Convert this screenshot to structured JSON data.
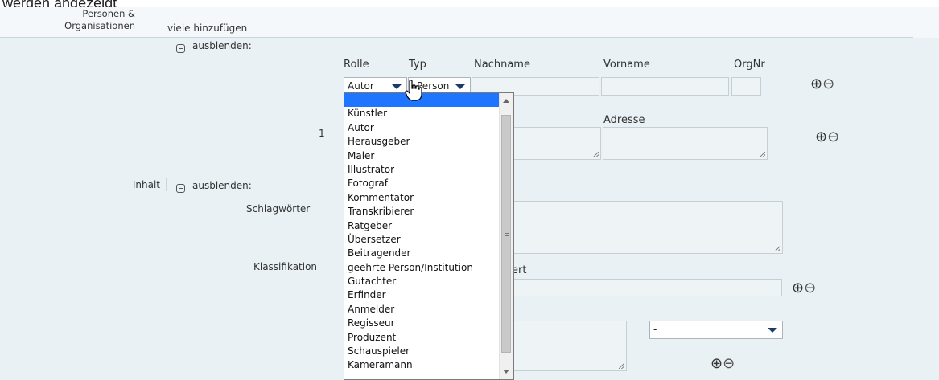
{
  "top_cut_text": "werden angezeigt",
  "personen": {
    "section_label_line1": "Personen &",
    "section_label_line2": "Organisationen",
    "add_many_link": "viele hinzufügen",
    "collapse_label": "ausblenden:",
    "columns": {
      "rolle": "Rolle",
      "typ": "Typ",
      "nachname": "Nachname",
      "vorname": "Vorname",
      "orgnr": "OrgNr"
    },
    "rolle_selected": "Autor",
    "typ_selected": "Person",
    "row_number": "1",
    "adresse_label": "Adresse"
  },
  "inhalt": {
    "section_label": "Inhalt",
    "collapse_label": "ausblenden:",
    "schlagwoerter_label": "Schlagwörter",
    "klassifikation_label": "Klassifikation",
    "klassifikation_partial_label": "ert",
    "select_value": "-"
  },
  "rolle_dropdown": {
    "options": [
      "-",
      "Künstler",
      "Autor",
      "Herausgeber",
      "Maler",
      "Illustrator",
      "Fotograf",
      "Kommentator",
      "Transkribierer",
      "Ratgeber",
      "Übersetzer",
      "Beitragender",
      "geehrte Person/Institution",
      "Gutachter",
      "Erfinder",
      "Anmelder",
      "Regisseur",
      "Produzent",
      "Schauspieler",
      "Kameramann"
    ],
    "highlighted_index": 0
  },
  "colors": {
    "highlight": "#1e75ff",
    "band": "#e9f1f5",
    "arrow": "#1a3a6b"
  },
  "icons": {
    "add": "plus-circle-icon",
    "remove": "minus-circle-icon",
    "collapse": "collapse-box-icon",
    "cursor": "hand-pointer-icon"
  }
}
